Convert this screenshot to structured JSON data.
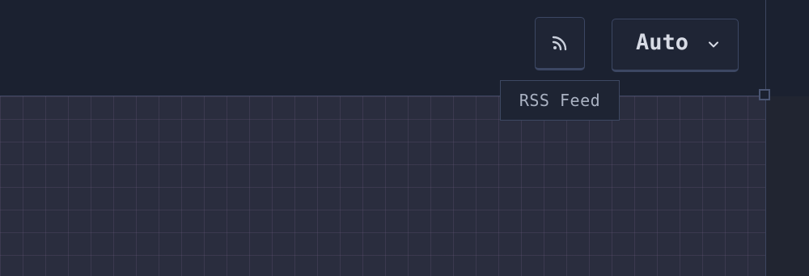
{
  "header": {
    "rss_button": {
      "icon": "rss-icon",
      "tooltip": "RSS Feed"
    },
    "theme_select": {
      "value": "Auto",
      "icon": "chevron-down-icon"
    }
  },
  "colors": {
    "background": "#1b2130",
    "grid_background": "#2a2d3e",
    "border": "#3c4763",
    "text_primary": "#d7dbe5",
    "text_secondary": "#aab2c2"
  }
}
